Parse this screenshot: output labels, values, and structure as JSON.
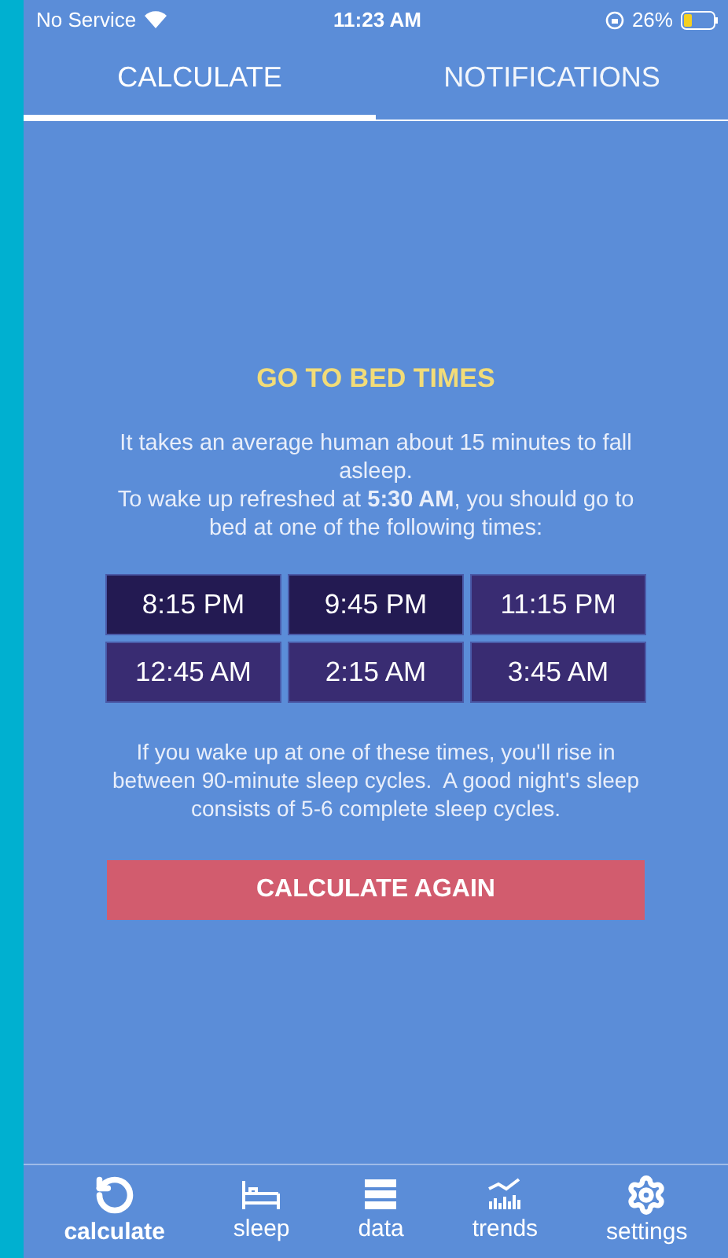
{
  "status_bar": {
    "carrier": "No Service",
    "time": "11:23 AM",
    "battery": "26%"
  },
  "tabs": [
    {
      "label": "CALCULATE",
      "selected": true
    },
    {
      "label": "NOTIFICATIONS",
      "selected": false
    }
  ],
  "heading": "GO TO BED TIMES",
  "intro": [
    "It takes an average human about 15 minutes to fall asleep.",
    "To wake up refreshed at **5:30 AM**, you should go to bed at one of the following times:"
  ],
  "times": [
    {
      "label": "8:15 PM",
      "selected": true
    },
    {
      "label": "9:45 PM",
      "selected": true
    },
    {
      "label": "11:15 PM",
      "selected": false
    },
    {
      "label": "12:45 AM",
      "selected": false
    },
    {
      "label": "2:15 AM",
      "selected": false
    },
    {
      "label": "3:45 AM",
      "selected": false
    }
  ],
  "note": "If you wake up at one of these times, you'll rise in between 90-minute sleep cycles.  A good night's sleep consists of 5-6 complete sleep cycles.",
  "action_button": "CALCULATE AGAIN",
  "nav": [
    {
      "label": "calculate",
      "kind": "refresh",
      "selected": true
    },
    {
      "label": "sleep",
      "kind": "bed",
      "selected": false
    },
    {
      "label": "data",
      "kind": "data",
      "selected": false
    },
    {
      "label": "trends",
      "kind": "trends",
      "selected": false
    },
    {
      "label": "settings",
      "kind": "gear",
      "selected": false
    }
  ]
}
